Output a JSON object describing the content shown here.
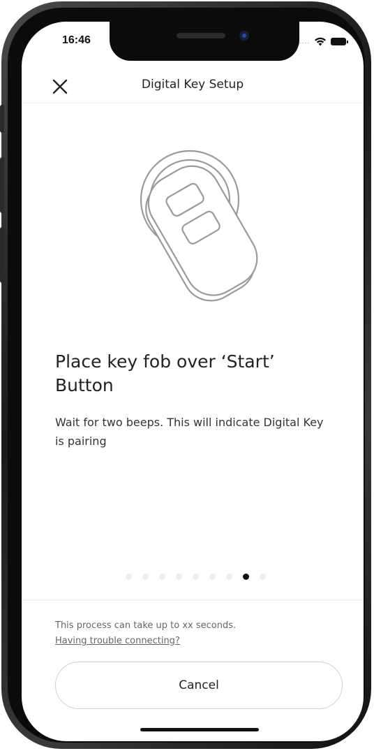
{
  "status_bar": {
    "time": "16:46",
    "signal": "....",
    "wifi_icon": "wifi-icon",
    "battery_icon": "battery-icon"
  },
  "header": {
    "title": "Digital Key Setup",
    "close_icon": "close-icon"
  },
  "illustration": {
    "icon": "key-fob-over-start-button-icon"
  },
  "content": {
    "headline": "Place key fob over ‘Start’ Button",
    "description": "Wait for two beeps. This will indicate Digital Key is pairing"
  },
  "pager": {
    "total": 9,
    "active": 8
  },
  "footer": {
    "note": "This process can take up to xx seconds.",
    "link": "Having trouble connecting?",
    "cancel_label": "Cancel"
  }
}
